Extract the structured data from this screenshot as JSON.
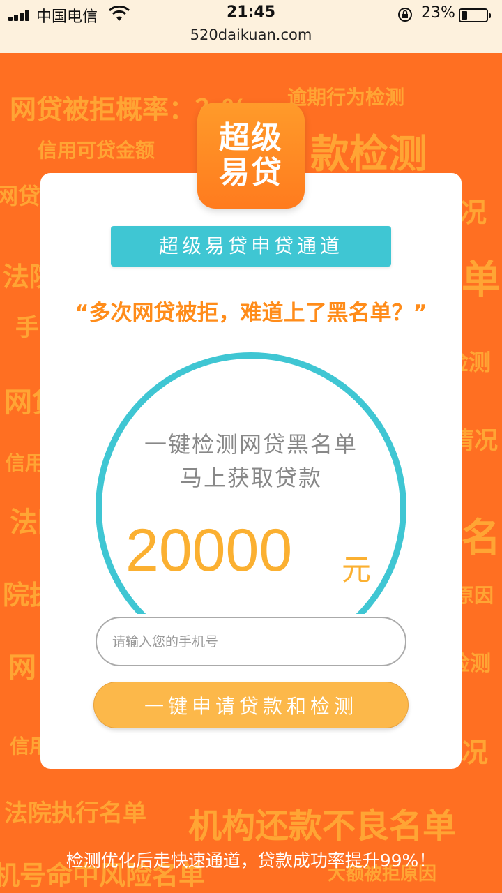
{
  "status_bar": {
    "carrier": "中国电信",
    "time": "21:45",
    "battery_pct": "23%",
    "battery_level": 0.23,
    "url": "520daikuan.com"
  },
  "background_words": [
    "网贷被拒概率：？%",
    "逾期行为检测",
    "信用可贷金额",
    "款检测",
    "网贷",
    "况",
    "法院",
    "单",
    "手",
    "检测",
    "网贷",
    "情况",
    "信用",
    "法院",
    "名",
    "院执",
    "原因",
    "网",
    "检测",
    "信用",
    "况",
    "法院执行名单",
    "机构还款不良名单",
    "机号命中风险名单",
    "大额被拒原因"
  ],
  "logo": {
    "line1": "超级",
    "line2": "易贷"
  },
  "card": {
    "channel_title": "超级易贷申贷通道",
    "headline": "“多次网贷被拒，难道上了黑名单？”",
    "promo_line1": "一键检测网贷黑名单",
    "promo_line2": "马上获取贷款",
    "amount": "20000",
    "unit": "元",
    "phone_placeholder": "请输入您的手机号",
    "apply_button": "一键申请贷款和检测"
  },
  "footer_note": "检测优化后走快速通道，贷款成功率提升99%！",
  "colors": {
    "background": "#ff6f22",
    "accent_teal": "#3fc6d3",
    "accent_orange": "#fbb031",
    "headline_orange": "#ff8c1a"
  }
}
